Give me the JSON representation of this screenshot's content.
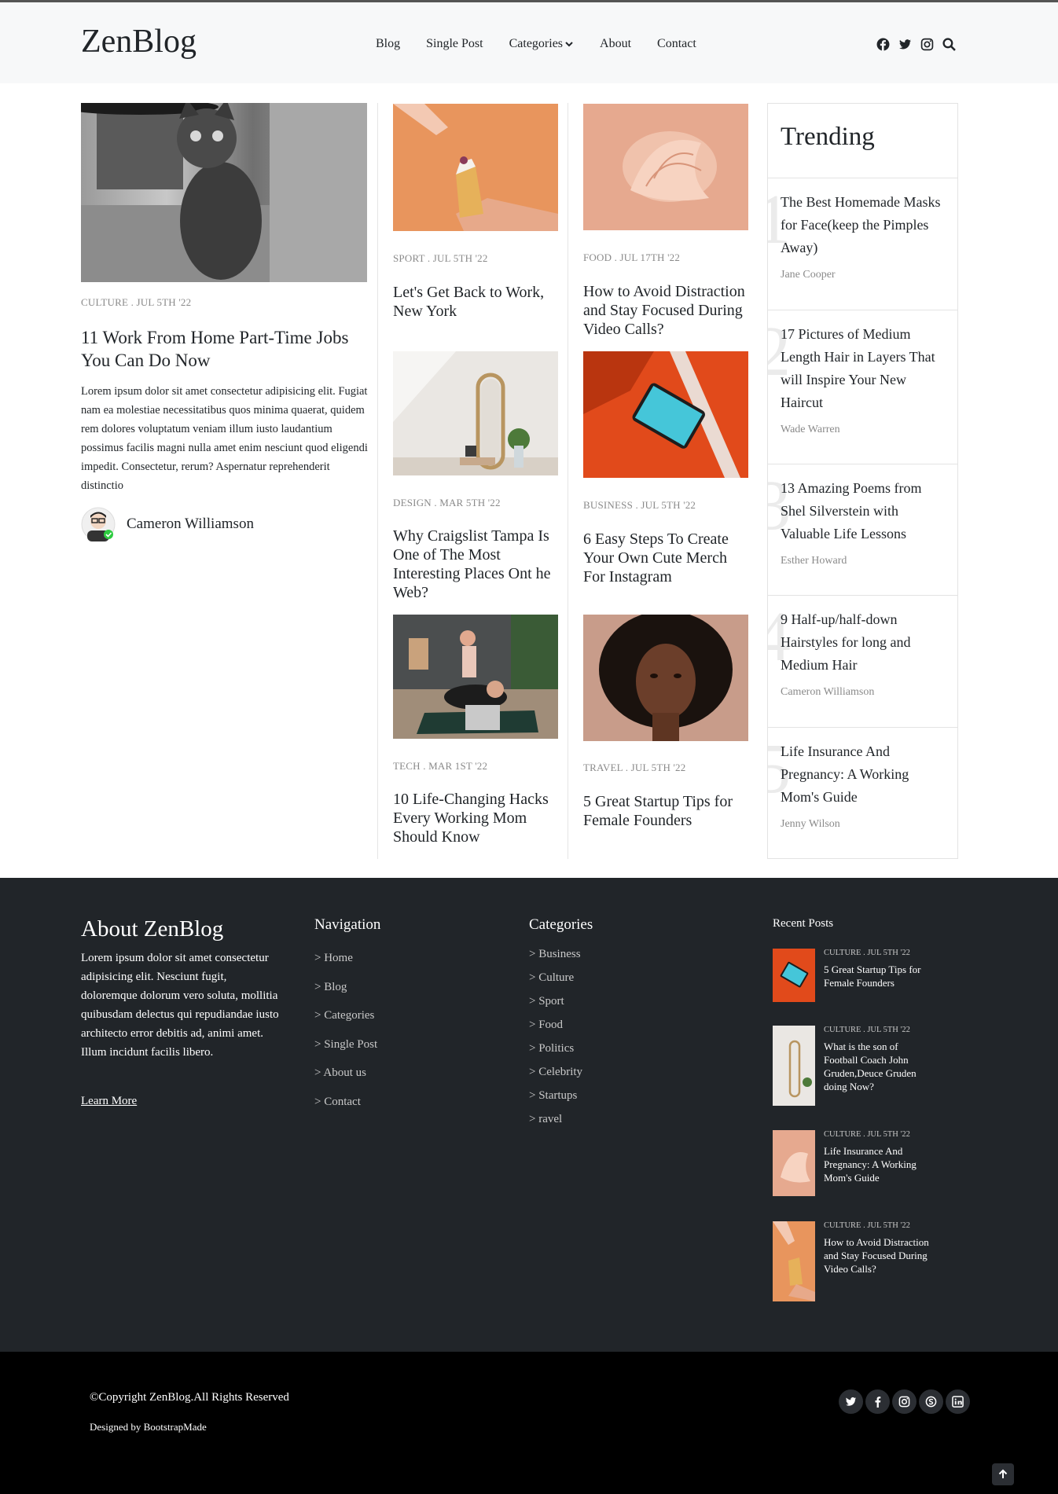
{
  "header": {
    "logo": "ZenBlog",
    "nav": [
      "Blog",
      "Single Post",
      "Categories",
      "About",
      "Contact"
    ]
  },
  "lead_post": {
    "meta": "CULTURE . JUL 5TH '22",
    "title": "11 Work From Home Part-Time Jobs You Can Do Now",
    "excerpt": "Lorem ipsum dolor sit amet consectetur adipisicing elit. Fugiat nam ea molestiae necessitatibus quos minima quaerat, quidem rem dolores voluptatum veniam illum iusto laudantium possimus facilis magni nulla amet enim nesciunt quod eligendi impedit. Consectetur, rerum? Aspernatur reprehenderit distinctio",
    "author": "Cameron Williamson"
  },
  "posts_col1": [
    {
      "meta": "SPORT . JUL 5TH '22",
      "title": "Let's Get Back to Work, New York"
    },
    {
      "meta": "DESIGN . MAR 5TH '22",
      "title": "Why Craigslist Tampa Is One of The Most Interesting Places Ont he Web?"
    },
    {
      "meta": "TECH . MAR 1ST '22",
      "title": "10 Life-Changing Hacks Every Working Mom Should Know"
    }
  ],
  "posts_col2": [
    {
      "meta": "FOOD . JUL 17TH '22",
      "title": "How to Avoid Distraction and Stay Focused During Video Calls?"
    },
    {
      "meta": "BUSINESS . JUL 5TH '22",
      "title": "6 Easy Steps To Create Your Own Cute Merch For Instagram"
    },
    {
      "meta": "TRAVEL . JUL 5TH '22",
      "title": "5 Great Startup Tips for Female Founders"
    }
  ],
  "trending": {
    "heading": "Trending",
    "items": [
      {
        "num": "1",
        "title": "The Best Homemade Masks for Face(keep the Pimples Away)",
        "author": "Jane Cooper"
      },
      {
        "num": "2",
        "title": "17 Pictures of Medium Length Hair in Layers That will Inspire Your New Haircut",
        "author": "Wade Warren"
      },
      {
        "num": "3",
        "title": "13 Amazing Poems from Shel Silverstein with Valuable Life Lessons",
        "author": "Esther Howard"
      },
      {
        "num": "4",
        "title": "9 Half-up/half-down Hairstyles for long and Medium Hair",
        "author": "Cameron Williamson"
      },
      {
        "num": "5",
        "title": "Life Insurance And Pregnancy: A Working Mom's Guide",
        "author": "Jenny Wilson"
      }
    ]
  },
  "footer": {
    "about_heading": "About ZenBlog",
    "about_text": "Lorem ipsum dolor sit amet consectetur adipisicing elit. Nesciunt fugit, doloremque dolorum vero soluta, mollitia quibusdam delectus qui repudiandae iusto architecto error debitis ad, animi amet. Illum incidunt facilis libero.",
    "learn_more": "Learn More",
    "nav_heading": "Navigation",
    "nav_links": [
      "> Home",
      "> Blog",
      "> Categories",
      "> Single Post",
      "> About us",
      "> Contact"
    ],
    "cat_heading": "Categories",
    "cat_links": [
      "> Business",
      "> Culture",
      "> Sport",
      "> Food",
      "> Politics",
      "> Celebrity",
      "> Startups",
      "> ravel"
    ],
    "recent_heading": "Recent Posts",
    "recent": [
      {
        "meta": "CULTURE . JUL 5TH '22",
        "title": "5 Great Startup Tips for Female Founders"
      },
      {
        "meta": "CULTURE . JUL 5TH '22",
        "title": "What is the son of Football Coach John Gruden,Deuce Gruden doing Now?"
      },
      {
        "meta": "CULTURE . JUL 5TH '22",
        "title": "Life Insurance And Pregnancy: A Working Mom's Guide"
      },
      {
        "meta": "CULTURE . JUL 5TH '22",
        "title": "How to Avoid Distraction and Stay Focused During Video Calls?"
      }
    ]
  },
  "copyright": {
    "text": "©Copyright ZenBlog.All Rights Reserved",
    "designed": "Designed by BootstrapMade"
  },
  "icons": {
    "header": [
      "facebook-icon",
      "twitter-icon",
      "instagram-icon",
      "search-icon"
    ],
    "social": [
      "twitter-icon",
      "facebook-icon",
      "instagram-icon",
      "skype-icon",
      "linkedin-icon"
    ]
  }
}
